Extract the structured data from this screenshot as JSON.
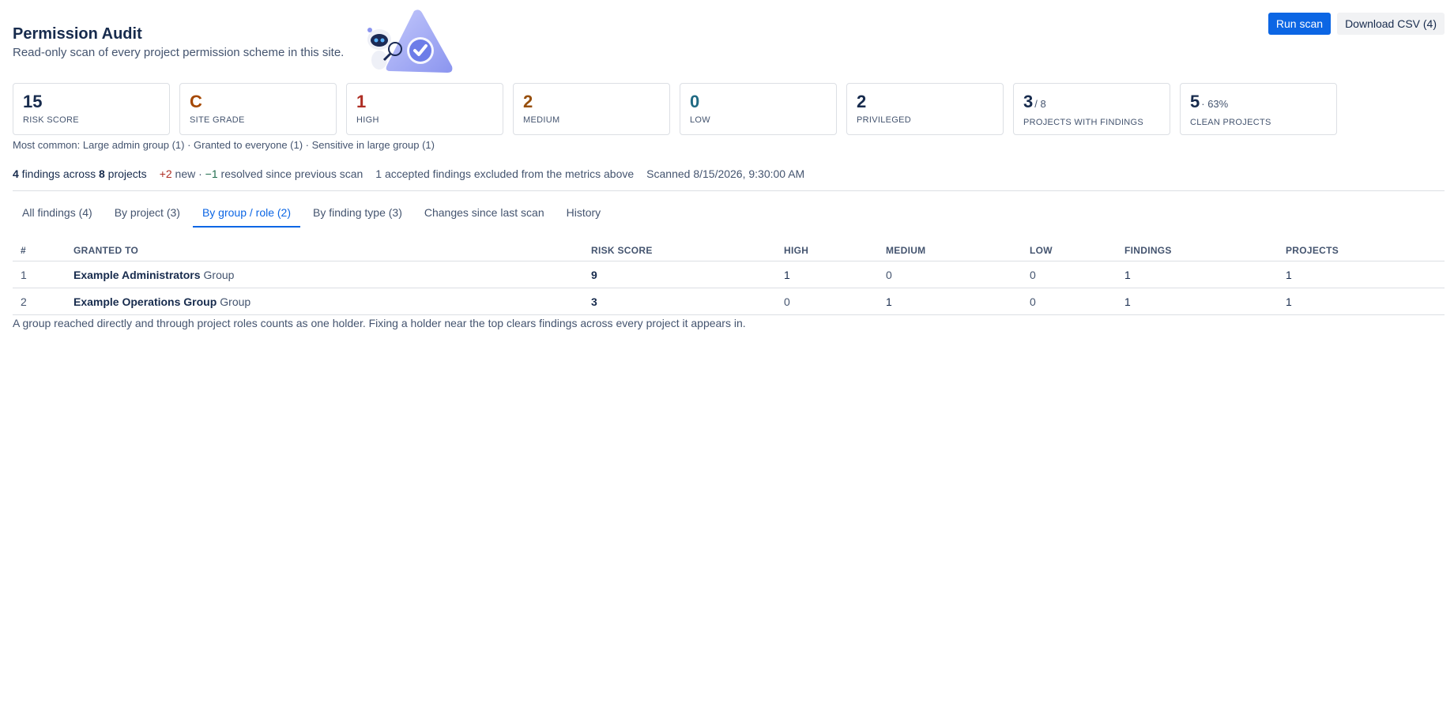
{
  "header": {
    "title": "Permission Audit",
    "subtitle": "Read-only scan of every project permission scheme in this site."
  },
  "actions": {
    "run_scan": "Run scan",
    "download_csv": "Download CSV (4)"
  },
  "metrics": [
    {
      "value": "15",
      "suffix": "",
      "label": "RISK SCORE",
      "color": "#172b4d"
    },
    {
      "value": "C",
      "suffix": "",
      "label": "SITE GRADE",
      "color": "#a54800"
    },
    {
      "value": "1",
      "suffix": "",
      "label": "HIGH",
      "color": "#ae2e24"
    },
    {
      "value": "2",
      "suffix": "",
      "label": "MEDIUM",
      "color": "#974f0c"
    },
    {
      "value": "0",
      "suffix": "",
      "label": "LOW",
      "color": "#206a83"
    },
    {
      "value": "2",
      "suffix": "",
      "label": "PRIVILEGED",
      "color": "#172b4d"
    },
    {
      "value": "3",
      "suffix": "/ 8",
      "label": "PROJECTS WITH FINDINGS",
      "color": "#172b4d"
    },
    {
      "value": "5",
      "suffix": "· 63%",
      "label": "CLEAN PROJECTS",
      "color": "#172b4d"
    }
  ],
  "most_common": "Most common: Large admin group (1) · Granted to everyone (1) · Sensitive in large group (1)",
  "summary": {
    "findings_count": "4",
    "findings_text": " findings across ",
    "projects_count": "8",
    "projects_text": " projects",
    "new_delta": "+2",
    "new_text": " new · ",
    "resolved_delta": "−1",
    "resolved_text": " resolved since previous scan",
    "excluded": "1 accepted findings excluded from the metrics above",
    "scanned": "Scanned 8/15/2026, 9:30:00 AM"
  },
  "tabs": [
    {
      "label": "All findings (4)",
      "active": false
    },
    {
      "label": "By project (3)",
      "active": false
    },
    {
      "label": "By group / role (2)",
      "active": true
    },
    {
      "label": "By finding type (3)",
      "active": false
    },
    {
      "label": "Changes since last scan",
      "active": false
    },
    {
      "label": "History",
      "active": false
    }
  ],
  "table": {
    "columns": [
      "#",
      "GRANTED TO",
      "RISK SCORE",
      "HIGH",
      "MEDIUM",
      "LOW",
      "FINDINGS",
      "PROJECTS"
    ],
    "rows": [
      {
        "num": "1",
        "name": "Example Administrators",
        "type": "Group",
        "risk": "9",
        "high": "1",
        "medium": "0",
        "low": "0",
        "findings": "1",
        "projects": "1"
      },
      {
        "num": "2",
        "name": "Example Operations Group",
        "type": "Group",
        "risk": "3",
        "high": "0",
        "medium": "1",
        "low": "0",
        "findings": "1",
        "projects": "1"
      }
    ]
  },
  "footnote": "A group reached directly and through project roles counts as one holder. Fixing a holder near the top clears findings across every project it appears in.",
  "colors": {
    "primary": "#0c66e4",
    "danger": "#ae2e24",
    "warning": "#b65c02",
    "illustration": "#9fa8f5"
  }
}
